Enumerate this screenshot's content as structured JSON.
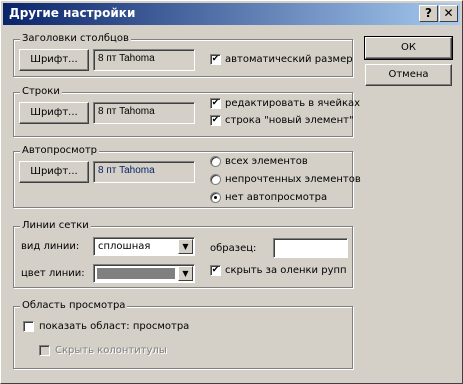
{
  "window": {
    "title": "Другие настройки",
    "help_glyph": "?",
    "close_glyph": "✕"
  },
  "buttons": {
    "ok": "ОК",
    "cancel": "Отмена"
  },
  "columns": {
    "title": "Заголовки столбцов",
    "font_button": "Шрифт...",
    "font_value": "8 пт Tahoma",
    "autosize_label": "автоматический размер",
    "autosize_checked": true
  },
  "rows": {
    "title": "Строки",
    "font_button": "Шрифт...",
    "font_value": "8 пт Tahoma",
    "edit_cells_label": "редактировать в ячейках",
    "edit_cells_checked": true,
    "new_item_label": "строка \"новый элемент\"",
    "new_item_checked": true
  },
  "autopreview": {
    "title": "Автопросмотр",
    "font_button": "Шрифт...",
    "font_value": "8 пт Tahoma",
    "options": [
      "всех элементов",
      "непрочтенных элементов",
      "нет автопросмотра"
    ],
    "selected_index": 2
  },
  "gridlines": {
    "title": "Линии сетки",
    "style_label": "вид линии:",
    "style_value": "сплошная",
    "color_label": "цвет линии:",
    "color_value": "#808080",
    "sample_label": "образец:",
    "hide_blank_label": "скрыть за оленки рупп",
    "hide_blank_checked": true
  },
  "reading_pane": {
    "title": "Область просмотра",
    "show_label": "показать област: просмотра",
    "show_checked": false,
    "hide_header_label": "Скрыть колонтитулы",
    "hide_header_checked": false
  },
  "icons": {
    "check": "✔",
    "dropdown": "▼"
  }
}
